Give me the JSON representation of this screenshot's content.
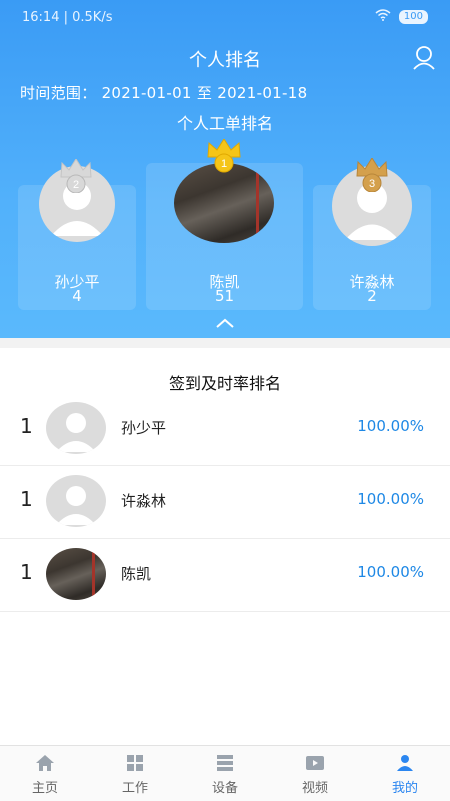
{
  "status_bar": {
    "time": "16:14",
    "speed": "0.5K/s",
    "battery": "100"
  },
  "header": {
    "title": "个人排名",
    "range_label": "时间范围：",
    "start_date": "2021-01-01",
    "range_sep": "至",
    "end_date": "2021-01-18",
    "subtitle": "个人工单排名"
  },
  "podium": [
    {
      "rank": "2",
      "name": "孙少平",
      "score": "4"
    },
    {
      "rank": "1",
      "name": "陈凯",
      "score": "51"
    },
    {
      "rank": "3",
      "name": "许淼林",
      "score": "2"
    }
  ],
  "attendance": {
    "title": "签到及时率排名",
    "rows": [
      {
        "rank": "1",
        "name": "孙少平",
        "rate": "100.00%"
      },
      {
        "rank": "1",
        "name": "许淼林",
        "rate": "100.00%"
      },
      {
        "rank": "1",
        "name": "陈凯",
        "rate": "100.00%"
      }
    ]
  },
  "tabs": [
    {
      "label": "主页",
      "icon": "home-icon"
    },
    {
      "label": "工作",
      "icon": "grid-icon"
    },
    {
      "label": "设备",
      "icon": "device-icon"
    },
    {
      "label": "视频",
      "icon": "video-icon"
    },
    {
      "label": "我的",
      "icon": "person-icon",
      "active": true
    }
  ],
  "colors": {
    "header_blue": "#3a9bf5",
    "accent": "#2b86f0",
    "rate_blue": "#1e88e5",
    "gold": "#f5c518",
    "silver": "#d8d8d8",
    "bronze": "#d4a04c"
  }
}
